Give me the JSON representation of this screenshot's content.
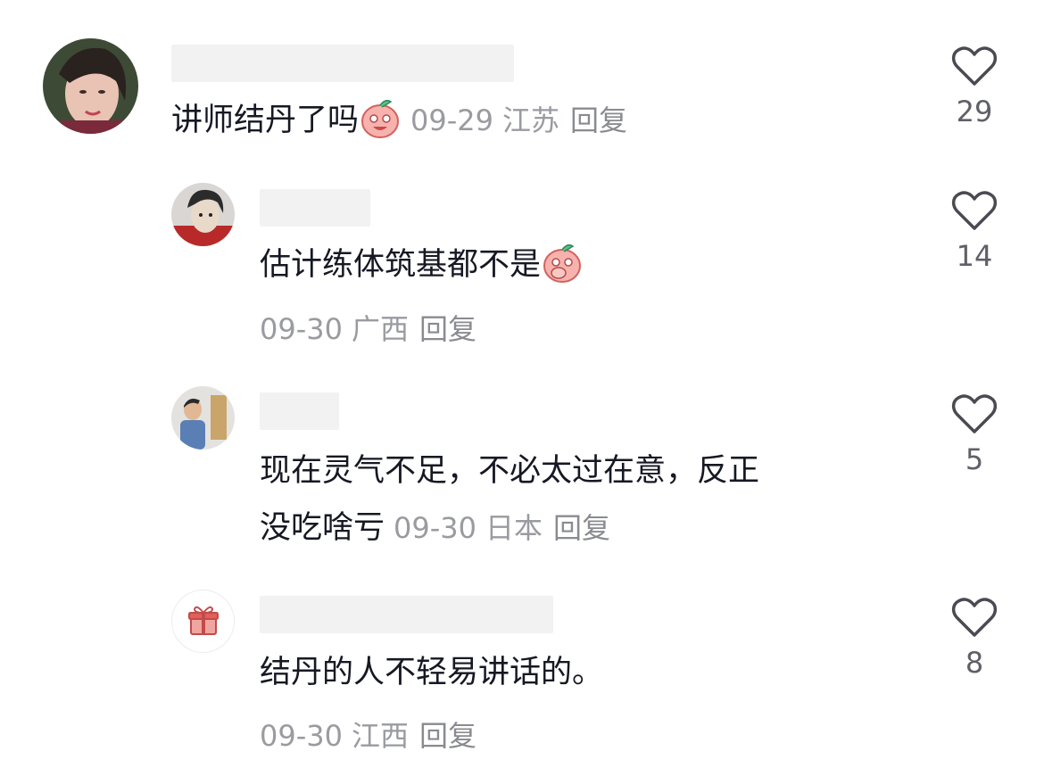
{
  "comments": [
    {
      "text": "讲师结丹了吗",
      "emoji": "peach-laugh-emoji",
      "date": "09-29",
      "location": "江苏",
      "reply": "回复",
      "likes": "29"
    },
    {
      "text": "估计练体筑基都不是",
      "emoji": "peach-cover-mouth-emoji",
      "date": "09-30",
      "location": "广西",
      "reply": "回复",
      "likes": "14"
    },
    {
      "text_line1": "现在灵气不足，不必太过在意，反正",
      "text_line2": "没吃啥亏",
      "date": "09-30",
      "location": "日本",
      "reply": "回复",
      "likes": "5"
    },
    {
      "text": "结丹的人不轻易讲话的。",
      "date": "09-30",
      "location": "江西",
      "reply": "回复",
      "likes": "8",
      "avatar_icon": "gift-icon"
    }
  ],
  "colors": {
    "text": "#161823",
    "meta": "#9a9ba1",
    "like_icon": "#4a4b52",
    "name_placeholder": "#f2f2f3"
  }
}
